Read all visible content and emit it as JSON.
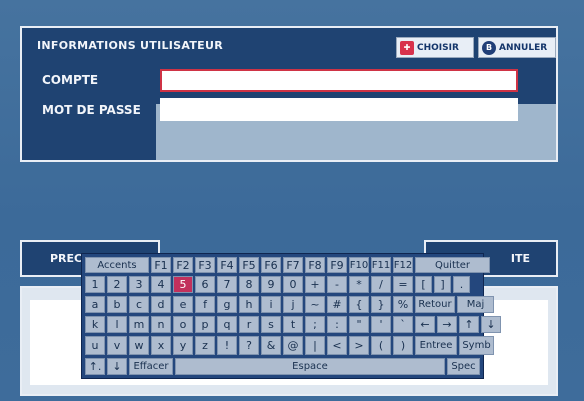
{
  "panel": {
    "title": "INFORMATIONS UTILISATEUR",
    "choose_label": "CHOISIR",
    "cancel_label": "ANNULER",
    "choose_icon": "button-a-icon",
    "cancel_icon": "button-b-icon",
    "cancel_icon_glyph": "B",
    "account_label": "COMPTE",
    "account_value": "",
    "password_label": "MOT DE PASSE",
    "password_value": ""
  },
  "nav": {
    "prev_label": "PREC",
    "next_label": "ITE"
  },
  "colors": {
    "accent_selected": "#c2305c",
    "field_border_active": "#cf3345",
    "panel_bg": "#1f4372"
  },
  "keyboard": {
    "selected": "5",
    "rows": [
      [
        "Accents",
        "F1",
        "F2",
        "F3",
        "F4",
        "F5",
        "F6",
        "F7",
        "F8",
        "F9",
        "F10",
        "F11",
        "F12",
        "Quitter"
      ],
      [
        "1",
        "2",
        "3",
        "4",
        "5",
        "6",
        "7",
        "8",
        "9",
        "0",
        "+",
        "-",
        "*",
        "/",
        "=",
        "[",
        "]",
        "."
      ],
      [
        "a",
        "b",
        "c",
        "d",
        "e",
        "f",
        "g",
        "h",
        "i",
        "j",
        "~",
        "#",
        "{",
        "}",
        "%",
        "Retour",
        "Maj"
      ],
      [
        "k",
        "l",
        "m",
        "n",
        "o",
        "p",
        "q",
        "r",
        "s",
        "t",
        ";",
        ":",
        "\"",
        "'",
        "`",
        "←",
        "→",
        "↑",
        "↓"
      ],
      [
        "u",
        "v",
        "w",
        "x",
        "y",
        "z",
        "!",
        "?",
        "&",
        "@",
        "|",
        "<",
        ">",
        "(",
        ")",
        "Entree",
        "Symb"
      ],
      [
        "↑.",
        "↓",
        "Effacer",
        "Espace",
        "Spec"
      ]
    ]
  }
}
